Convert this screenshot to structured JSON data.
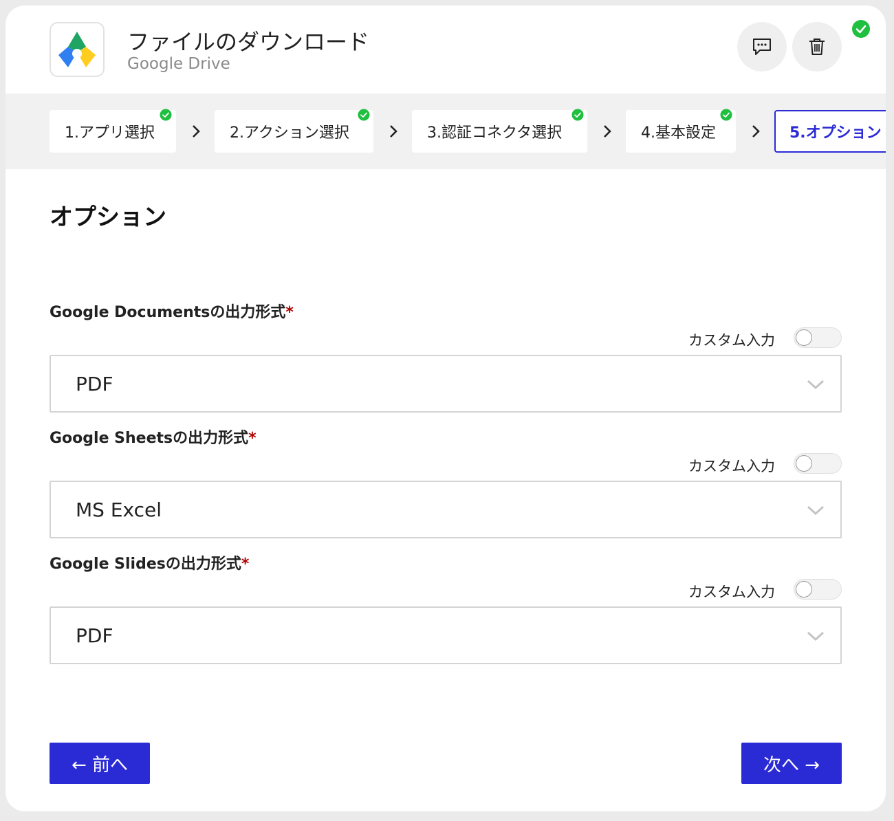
{
  "header": {
    "title": "ファイルのダウンロード",
    "subtitle": "Google Drive",
    "comment_icon": "comment-icon",
    "delete_icon": "trash-icon",
    "status_icon": "check-circle-icon"
  },
  "steps": [
    {
      "label": "1.アプリ選択",
      "completed": true
    },
    {
      "label": "2.アクション選択",
      "completed": true
    },
    {
      "label": "3.認証コネクタ選択",
      "completed": true
    },
    {
      "label": "4.基本設定",
      "completed": true
    },
    {
      "label": "5.オプション",
      "completed": false,
      "active": true
    }
  ],
  "section": {
    "title": "オプション",
    "fields": [
      {
        "label": "Google Documentsの出力形式",
        "required_mark": "*",
        "custom_label": "カスタム入力",
        "value": "PDF"
      },
      {
        "label": "Google Sheetsの出力形式",
        "required_mark": "*",
        "custom_label": "カスタム入力",
        "value": "MS Excel"
      },
      {
        "label": "Google Slidesの出力形式",
        "required_mark": "*",
        "custom_label": "カスタム入力",
        "value": "PDF"
      }
    ]
  },
  "footer": {
    "prev_label": "← 前へ",
    "next_label": "次へ →"
  },
  "colors": {
    "accent": "#2b2bd6",
    "success": "#1fbf3f",
    "required": "#b00000"
  }
}
